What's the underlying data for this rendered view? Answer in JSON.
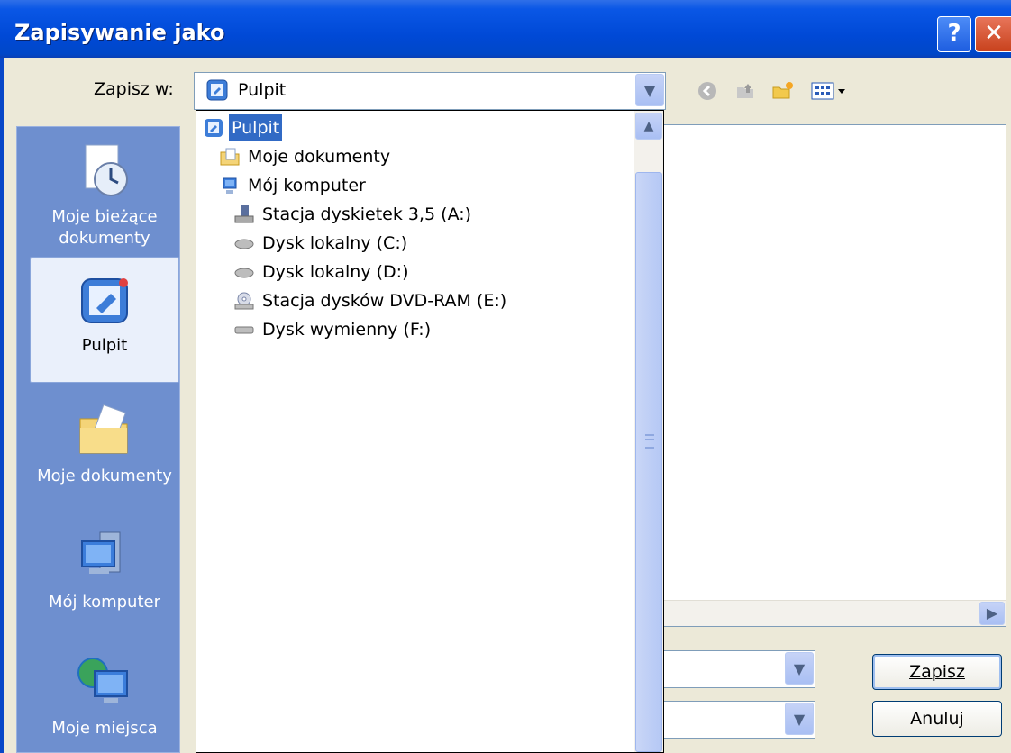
{
  "window": {
    "title": "Zapisywanie jako",
    "help_glyph": "?",
    "close_glyph": "✕"
  },
  "save_in": {
    "label": "Zapisz w:",
    "value": "Pulpit"
  },
  "toolbar": {
    "icons": [
      "back-icon",
      "up-folder-icon",
      "new-folder-icon",
      "view-menu-icon"
    ]
  },
  "places": [
    {
      "label": "Moje bieżące dokumenty",
      "icon": "recent-documents-icon"
    },
    {
      "label": "Pulpit",
      "icon": "desktop-icon",
      "active": true
    },
    {
      "label": "Moje dokumenty",
      "icon": "my-documents-icon"
    },
    {
      "label": "Mój komputer",
      "icon": "my-computer-icon"
    },
    {
      "label": "Moje miejsca",
      "icon": "network-places-icon"
    }
  ],
  "dropdown": {
    "items": [
      {
        "label": "Pulpit",
        "icon": "desktop-icon",
        "selected": true
      },
      {
        "label": "Moje dokumenty",
        "icon": "my-documents-icon"
      },
      {
        "label": "Mój komputer",
        "icon": "my-computer-icon"
      },
      {
        "label": "Stacja dyskietek 3,5 (A:)",
        "icon": "floppy-drive-icon"
      },
      {
        "label": "Dysk lokalny (C:)",
        "icon": "hard-drive-icon"
      },
      {
        "label": "Dysk lokalny (D:)",
        "icon": "hard-drive-icon"
      },
      {
        "label": "Stacja dysków DVD-RAM (E:)",
        "icon": "dvd-drive-icon"
      },
      {
        "label": "Dysk wymienny (F:)",
        "icon": "removable-drive-icon"
      }
    ]
  },
  "buttons": {
    "save": "Zapisz",
    "cancel": "Anuluj"
  },
  "colors": {
    "titlebar": "#0A57E6",
    "selection": "#316AC5",
    "places_bg": "#6E8FCF",
    "dialog_bg": "#ECE9D8"
  }
}
